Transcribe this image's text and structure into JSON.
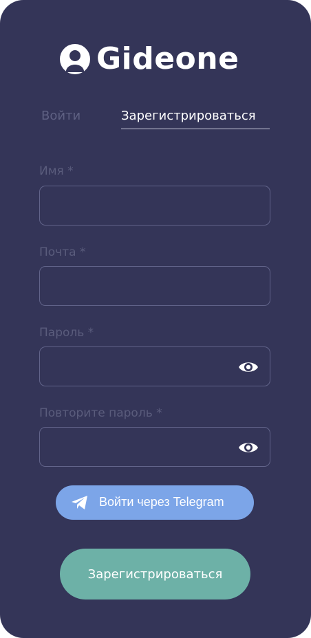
{
  "app": {
    "logo_text": "Gideone",
    "logo_icon": "user-avatar-icon"
  },
  "tabs": {
    "login_label": "Войти",
    "register_label": "Зарегистрироваться",
    "active": "register"
  },
  "form": {
    "name": {
      "label": "Имя *",
      "value": ""
    },
    "email": {
      "label": "Почта *",
      "value": ""
    },
    "password": {
      "label": "Пароль *",
      "value": "",
      "toggle_icon": "eye-icon"
    },
    "password_repeat": {
      "label": "Повторите пароль *",
      "value": "",
      "toggle_icon": "eye-icon"
    }
  },
  "telegram_button": {
    "label": "Войти через Telegram",
    "icon": "telegram-paper-plane-icon"
  },
  "submit_button": {
    "label": "Зарегистрироваться"
  },
  "colors": {
    "background": "#343558",
    "telegram_button": "#7ca5e8",
    "submit_button": "#6db1a7",
    "field_border": "#62648a",
    "label_muted": "#5a5c7c"
  }
}
